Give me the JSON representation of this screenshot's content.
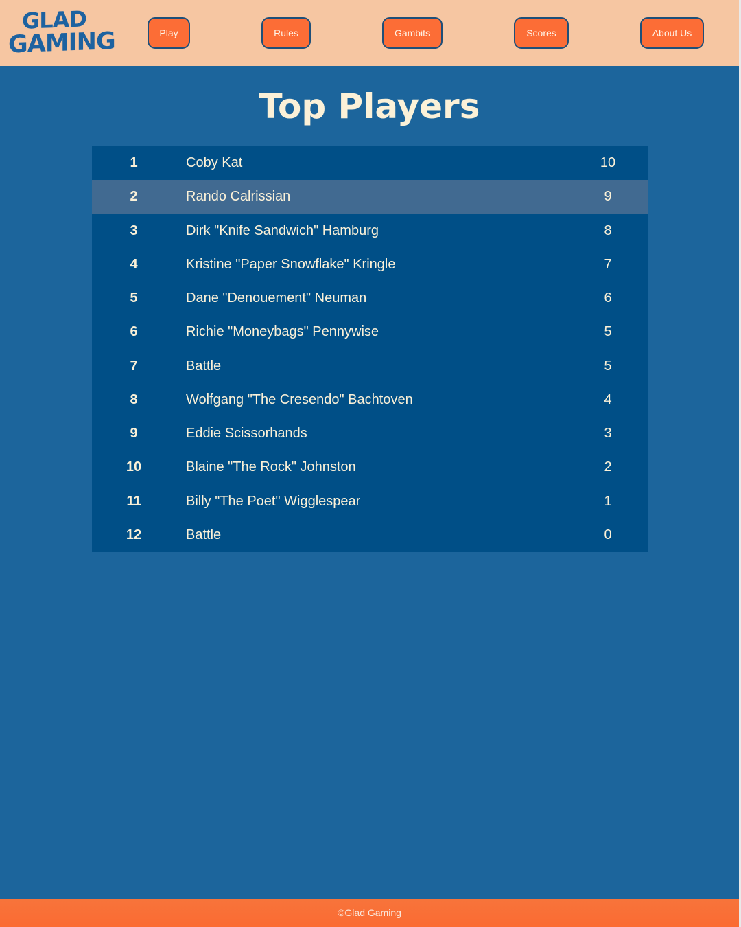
{
  "logo": {
    "line1": "GLAD",
    "line2": "GAMING"
  },
  "nav": {
    "play": "Play",
    "rules": "Rules",
    "gambits": "Gambits",
    "scores": "Scores",
    "about": "About Us"
  },
  "page_title": "Top Players",
  "players": [
    {
      "rank": "1",
      "name": "Coby Kat",
      "score": "10"
    },
    {
      "rank": "2",
      "name": "Rando Calrissian",
      "score": "9"
    },
    {
      "rank": "3",
      "name": "Dirk \"Knife Sandwich\" Hamburg",
      "score": "8"
    },
    {
      "rank": "4",
      "name": "Kristine \"Paper Snowflake\" Kringle",
      "score": "7"
    },
    {
      "rank": "5",
      "name": "Dane \"Denouement\" Neuman",
      "score": "6"
    },
    {
      "rank": "6",
      "name": "Richie \"Moneybags\" Pennywise",
      "score": "5"
    },
    {
      "rank": "7",
      "name": "Battle",
      "score": "5"
    },
    {
      "rank": "8",
      "name": "Wolfgang \"The Cresendo\" Bachtoven",
      "score": "4"
    },
    {
      "rank": "9",
      "name": "Eddie Scissorhands",
      "score": "3"
    },
    {
      "rank": "10",
      "name": "Blaine \"The Rock\" Johnston",
      "score": "2"
    },
    {
      "rank": "11",
      "name": "Billy \"The Poet\" Wigglespear",
      "score": "1"
    },
    {
      "rank": "12",
      "name": "Battle",
      "score": "0"
    }
  ],
  "footer": {
    "copyright": "©Glad Gaming"
  },
  "colors": {
    "background": "#1c659c",
    "header": "#f6c6a2",
    "button": "#fc6d36",
    "table": "#004f87",
    "highlight_row": "#416a91",
    "text": "#fbf1d8"
  }
}
